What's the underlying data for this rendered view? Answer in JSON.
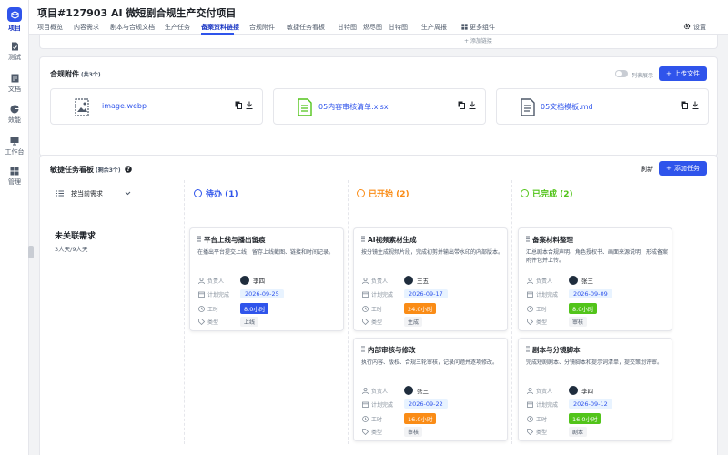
{
  "sidebar": {
    "items": [
      {
        "label": "项目",
        "icon": "cube-icon",
        "active": true
      },
      {
        "label": "测试",
        "icon": "file-check-icon"
      },
      {
        "label": "文档",
        "icon": "document-icon"
      },
      {
        "label": "效能",
        "icon": "pie-chart-icon"
      },
      {
        "label": "工作台",
        "icon": "monitor-icon"
      },
      {
        "label": "管理",
        "icon": "grid-icon"
      }
    ]
  },
  "header": {
    "title": "项目#127903 AI 微短剧合规生产交付项目",
    "tabs": [
      "项目概览",
      "内容需求",
      "剧本与合规文档",
      "生产任务",
      "备案资料链接",
      "合规附件",
      "敏捷任务看板",
      "甘特图",
      "燃尽图",
      "甘特图",
      "生产周报"
    ],
    "more_label": "更多组件",
    "settings_label": "设置"
  },
  "strip_text": "+ 添加链接",
  "attachments": {
    "title": "合规附件",
    "count": "(共3个)",
    "toggle_label": "列表展示",
    "upload_label": "上传文件",
    "files": [
      {
        "name": "image.webp",
        "icon": "image-file-icon"
      },
      {
        "name": "05内容审核清单.xlsx",
        "icon": "spreadsheet-file-icon"
      },
      {
        "name": "05文档模板.md",
        "icon": "text-file-icon"
      }
    ]
  },
  "board": {
    "title": "敏捷任务看板",
    "count": "(剩余3个)",
    "refresh_label": "刷新",
    "add_label": "添加任务",
    "filter_label": "按当前需求",
    "group": {
      "name": "未关联需求",
      "sub": "3人天/9人天"
    },
    "columns": [
      {
        "label": "待办 (1)",
        "color": "#2f54eb"
      },
      {
        "label": "已开始 (2)",
        "color": "#fa8c16"
      },
      {
        "label": "已完成 (2)",
        "color": "#52c41a"
      }
    ],
    "field_labels": {
      "owner": "负责人",
      "plan": "计划完成",
      "hours": "工时",
      "type": "类型"
    },
    "cards": [
      {
        "title": "平台上线与播出留痕",
        "desc": "在播出平台提交上线，留存上线截图、链接和时间记录。",
        "owner": "李四",
        "date": "2026-09-25",
        "hours": "8.0小时",
        "hours_color": "#2f54eb",
        "type": "上线"
      },
      {
        "title": "AI视频素材生成",
        "desc": "按分镜生成视频片段，完成初剪并输出带水印的内部版本。",
        "owner": "王五",
        "date": "2026-09-17",
        "hours": "24.0小时",
        "hours_color": "#fa8c16",
        "type": "生成"
      },
      {
        "title": "备案材料整理",
        "desc": "汇总剧本合规声明、角色授权书、画面来源说明，形成备案附件包并上传。",
        "owner": "张三",
        "date": "2026-09-09",
        "hours": "8.0小时",
        "hours_color": "#52c41a",
        "type": "审核"
      },
      {
        "title": "内部审核与修改",
        "desc": "执行内容、版权、合规三轮审核，记录问题并逐项修改。",
        "owner": "张三",
        "date": "2026-09-22",
        "hours": "16.0小时",
        "hours_color": "#fa8c16",
        "type": "审核"
      },
      {
        "title": "剧本与分镜脚本",
        "desc": "完成短剧剧本、分镜脚本和提示词清单，提交策划评审。",
        "owner": "李四",
        "date": "2026-09-12",
        "hours": "16.0小时",
        "hours_color": "#52c41a",
        "type": "剧本"
      }
    ]
  }
}
